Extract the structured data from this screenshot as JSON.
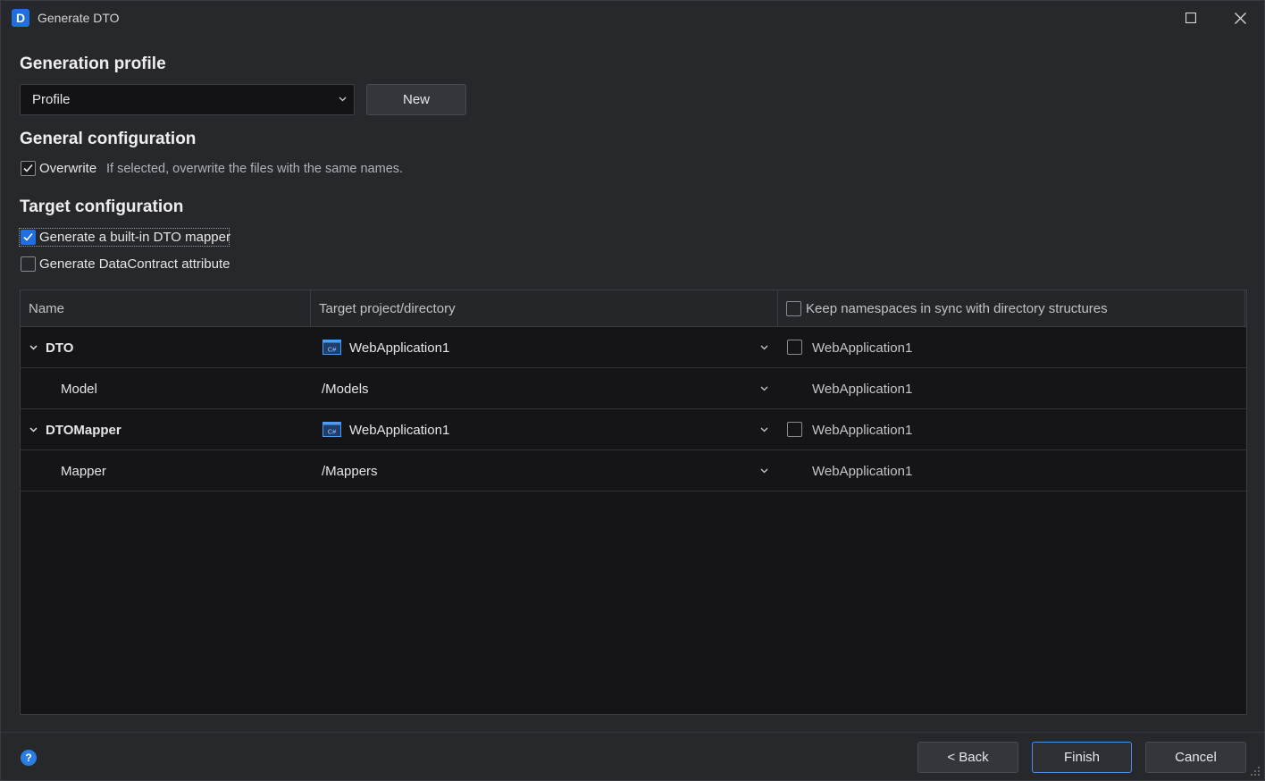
{
  "window": {
    "title": "Generate DTO",
    "app_icon_letter": "D"
  },
  "generation_profile": {
    "heading": "Generation profile",
    "profile_value": "Profile",
    "new_button": "New"
  },
  "general_configuration": {
    "heading": "General configuration",
    "overwrite": {
      "label": "Overwrite",
      "checked": true,
      "hint": "If selected, overwrite the files with the same names."
    }
  },
  "target_configuration": {
    "heading": "Target configuration",
    "mapper": {
      "label": "Generate a built-in DTO mapper",
      "checked": true
    },
    "datacontract": {
      "label": "Generate DataContract attribute",
      "checked": false
    }
  },
  "table": {
    "columns": [
      "Name",
      "Target project/directory",
      "Keep namespaces in sync with directory structures"
    ],
    "keep_in_sync_checked": false,
    "rows": [
      {
        "name": "DTO",
        "level": 0,
        "expanded": true,
        "target": "WebApplication1",
        "project_icon": "csharp-project-icon",
        "namespace": "WebApplication1",
        "namespace_checkbox": true
      },
      {
        "name": "Model",
        "level": 1,
        "target": "/Models",
        "namespace": "WebApplication1",
        "namespace_checkbox": false
      },
      {
        "name": "DTOMapper",
        "level": 0,
        "expanded": true,
        "target": "WebApplication1",
        "project_icon": "csharp-project-icon",
        "namespace": "WebApplication1",
        "namespace_checkbox": true
      },
      {
        "name": "Mapper",
        "level": 1,
        "target": "/Mappers",
        "namespace": "WebApplication1",
        "namespace_checkbox": false
      }
    ]
  },
  "footer": {
    "help_icon": "?",
    "back_button": "< Back",
    "finish_button": "Finish",
    "cancel_button": "Cancel"
  },
  "colors": {
    "background": "#27282c",
    "accent": "#1f6fe0",
    "table_background": "#151518"
  }
}
